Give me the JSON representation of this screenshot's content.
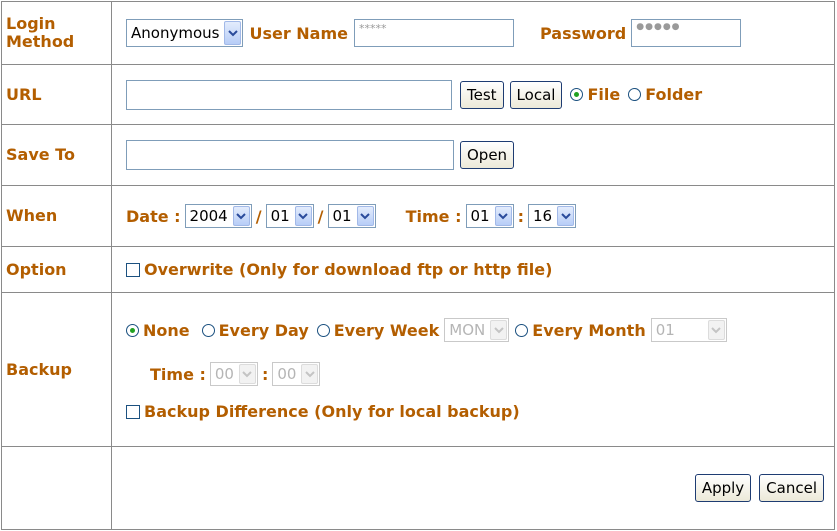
{
  "login": {
    "label": "Login Method",
    "method_value": "Anonymous",
    "username_label": "User Name",
    "username_value": "*****",
    "password_label": "Password",
    "password_value": "●●●●●"
  },
  "url": {
    "label": "URL",
    "value": "",
    "test_label": "Test",
    "local_label": "Local",
    "file_label": "File",
    "folder_label": "Folder",
    "selected": "File"
  },
  "save_to": {
    "label": "Save To",
    "value": "",
    "open_label": "Open"
  },
  "when": {
    "label": "When",
    "date_label": "Date :",
    "year": "2004",
    "month": "01",
    "day": "01",
    "slash": "/",
    "time_label": "Time :",
    "hour": "01",
    "colon": ":",
    "minute": "16"
  },
  "option": {
    "label": "Option",
    "overwrite_label": "Overwrite (Only for download ftp or http file)",
    "overwrite_checked": false
  },
  "backup": {
    "label": "Backup",
    "none_label": "None",
    "every_day_label": "Every Day",
    "every_week_label": "Every Week",
    "week_value": "MON",
    "every_month_label": "Every Month",
    "month_value": "01",
    "selected": "None",
    "time_label": "Time :",
    "hour": "00",
    "colon": ":",
    "minute": "00",
    "difference_label": "Backup Difference (Only for local backup)",
    "difference_checked": false
  },
  "actions": {
    "apply_label": "Apply",
    "cancel_label": "Cancel"
  },
  "colors": {
    "label_orange": "#b35e00",
    "border": "#8a8a8a",
    "radio_dot": "#21a121"
  }
}
